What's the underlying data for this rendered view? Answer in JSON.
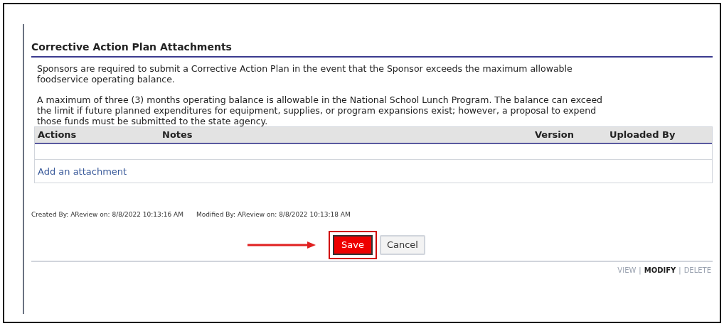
{
  "section": {
    "title": "Corrective Action Plan Attachments"
  },
  "paragraphs": [
    "Sponsors are required to submit a Corrective Action Plan in the event that the Sponsor exceeds the maximum allowable foodservice operating balance.",
    "A maximum of three (3) months operating balance is allowable in the National School Lunch Program. The balance can exceed the limit if future planned expenditures for equipment, supplies, or program expansions exist; however, a proposal to expend those funds must be submitted to the state agency."
  ],
  "table": {
    "columns": [
      "Actions",
      "Notes",
      "Version",
      "Uploaded By"
    ],
    "add_link": "Add an attachment"
  },
  "audit": [
    "Created By: AReview on: 8/8/2022 10:13:16 AM",
    "Modified By: AReview on: 8/8/2022 10:13:18 AM"
  ],
  "buttons": [
    {
      "label": "Save",
      "kind": "primary",
      "highlighted": true
    },
    {
      "label": "Cancel",
      "kind": "secondary",
      "highlighted": false
    }
  ],
  "modes": [
    {
      "label": "VIEW",
      "selected": false
    },
    {
      "label": "MODIFY",
      "selected": true
    },
    {
      "label": "DELETE",
      "selected": false
    }
  ],
  "separators": [
    "|",
    "|"
  ]
}
